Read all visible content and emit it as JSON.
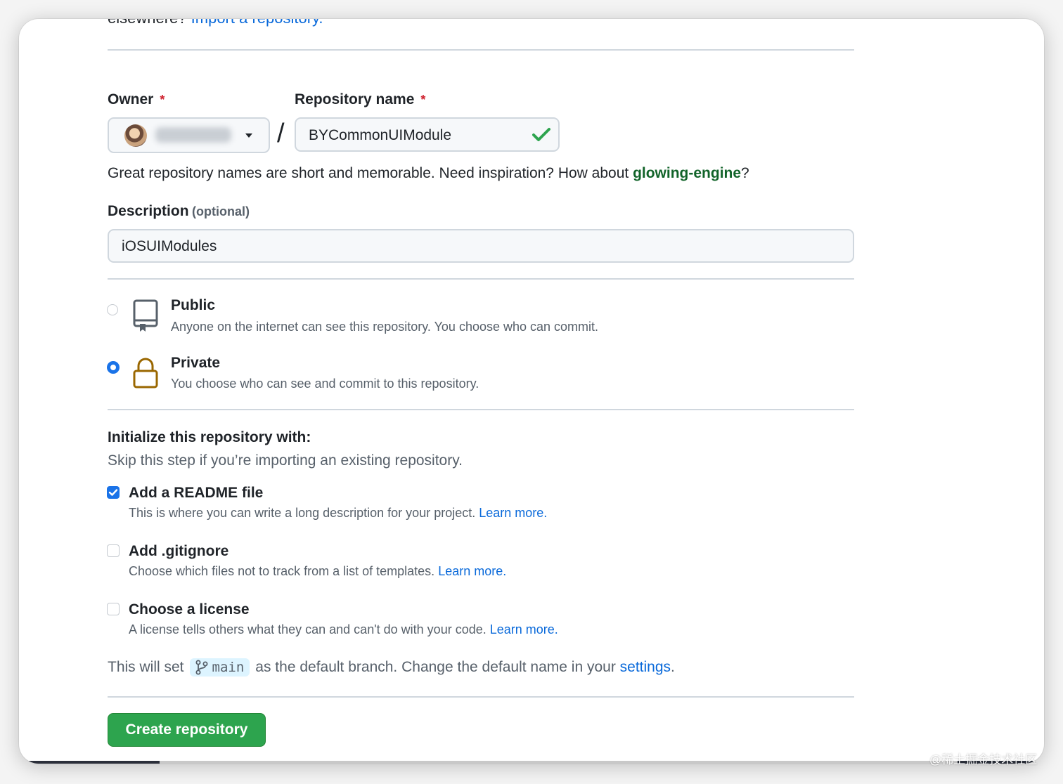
{
  "intro": {
    "prefix": "elsewhere?",
    "import_link": "Import a repository."
  },
  "owner": {
    "label": "Owner",
    "required_mark": "*"
  },
  "repo_name": {
    "label": "Repository name",
    "required_mark": "*",
    "value": "BYCommonUIModule",
    "separator": "/"
  },
  "suggestion": {
    "prefix": "Great repository names are short and memorable. Need inspiration? How about ",
    "name": "glowing-engine",
    "suffix": "?"
  },
  "description": {
    "label": "Description",
    "optional": "(optional)",
    "value": "iOSUIModules"
  },
  "visibility": [
    {
      "title": "Public",
      "desc": "Anyone on the internet can see this repository. You choose who can commit.",
      "selected": false
    },
    {
      "title": "Private",
      "desc": "You choose who can see and commit to this repository.",
      "selected": true
    }
  ],
  "init": {
    "heading": "Initialize this repository with:",
    "subheading": "Skip this step if you’re importing an existing repository.",
    "options": [
      {
        "title": "Add a README file",
        "desc": "This is where you can write a long description for your project.",
        "link": "Learn more.",
        "checked": true
      },
      {
        "title": "Add .gitignore",
        "desc": "Choose which files not to track from a list of templates.",
        "link": "Learn more.",
        "checked": false
      },
      {
        "title": "Choose a license",
        "desc": "A license tells others what they can and can't do with your code.",
        "link": "Learn more.",
        "checked": false
      }
    ]
  },
  "branch_note": {
    "prefix": "This will set",
    "branch": "main",
    "middle": "as the default branch. Change the default name in your",
    "link": "settings",
    "suffix": "."
  },
  "submit": {
    "label": "Create repository"
  },
  "watermark": "@稀土掘金技术社区",
  "colors": {
    "accent": "#0969da",
    "success": "#2da44e",
    "danger": "#cf222e",
    "suggestion": "#116329",
    "radio": "#1a73e8",
    "lock": "#9a6700"
  }
}
